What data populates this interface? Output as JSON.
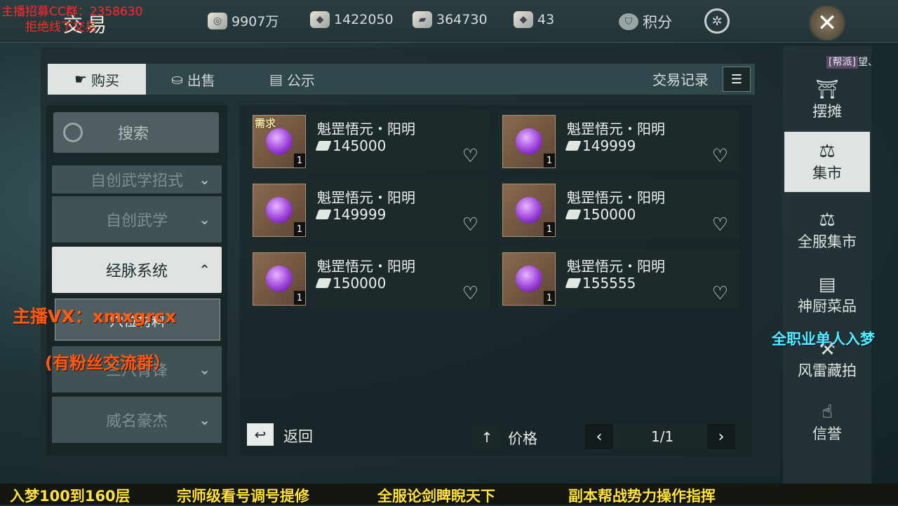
{
  "header": {
    "title": "交易",
    "currencies": [
      {
        "icon": "coin-icon",
        "value": "9907万"
      },
      {
        "icon": "silver-ingot-icon",
        "value": "1422050"
      },
      {
        "icon": "jade-icon",
        "value": "364730"
      },
      {
        "icon": "gold-ingot-icon",
        "value": "43"
      }
    ],
    "points_label": "积分"
  },
  "tabs": [
    {
      "label": "购买",
      "active": true
    },
    {
      "label": "出售",
      "active": false
    },
    {
      "label": "公示",
      "active": false
    }
  ],
  "trade_record_label": "交易记录",
  "sidebar_left": {
    "search_label": "搜索",
    "menus": [
      {
        "label": "自创武学招式",
        "expanded": false
      },
      {
        "label": "自创武学",
        "expanded": false
      },
      {
        "label": "经脉系统",
        "expanded": true
      },
      {
        "label": "三八青锋",
        "expanded": false
      },
      {
        "label": "威名豪杰",
        "expanded": false
      }
    ],
    "submenu": [
      "穴位材料"
    ]
  },
  "items": [
    {
      "name": "魁罡悟元・阳明",
      "price": "145000",
      "qty": "1",
      "tag": "需求"
    },
    {
      "name": "魁罡悟元・阳明",
      "price": "149999",
      "qty": "1",
      "tag": ""
    },
    {
      "name": "魁罡悟元・阳明",
      "price": "149999",
      "qty": "1",
      "tag": ""
    },
    {
      "name": "魁罡悟元・阳明",
      "price": "150000",
      "qty": "1",
      "tag": ""
    },
    {
      "name": "魁罡悟元・阳明",
      "price": "150000",
      "qty": "1",
      "tag": ""
    },
    {
      "name": "魁罡悟元・阳明",
      "price": "155555",
      "qty": "1",
      "tag": ""
    }
  ],
  "controls": {
    "back_label": "返回",
    "sort_label": "价格",
    "page": "1/1"
  },
  "sidebar_right": {
    "guild_tag": "[帮派]",
    "guild_name": "望、",
    "items": [
      {
        "label": "摆摊",
        "icon": "stall-icon",
        "active": false
      },
      {
        "label": "集市",
        "icon": "scale-icon",
        "active": true
      },
      {
        "label": "全服集市",
        "icon": "scale-icon",
        "active": false
      },
      {
        "label": "神厨菜品",
        "icon": "kitchen-icon",
        "active": false
      },
      {
        "label": "风雷藏拍",
        "icon": "auction-icon",
        "active": false
      },
      {
        "label": "信誉",
        "icon": "hand-icon",
        "active": false
      }
    ]
  },
  "overlays": {
    "recruit": "主播招募CC群：2358630",
    "refuse": "拒绝线下交易",
    "vx": "主播VX：xmxgrcx",
    "fans": "(有粉丝交流群）",
    "all_class": "全职业单人入梦",
    "bottom": [
      "入梦100到160层",
      "宗师级看号调号提修",
      "全服论剑睥睨天下",
      "副本帮战势力操作指挥"
    ]
  },
  "colors": {
    "accent_active": "#dfe4e3",
    "panel": "#30474b",
    "orb": "#9b3fd8",
    "overlay_red": "#ff2a2a",
    "overlay_cyan": "#4ff3ff",
    "overlay_yellow": "#ffe23a"
  }
}
